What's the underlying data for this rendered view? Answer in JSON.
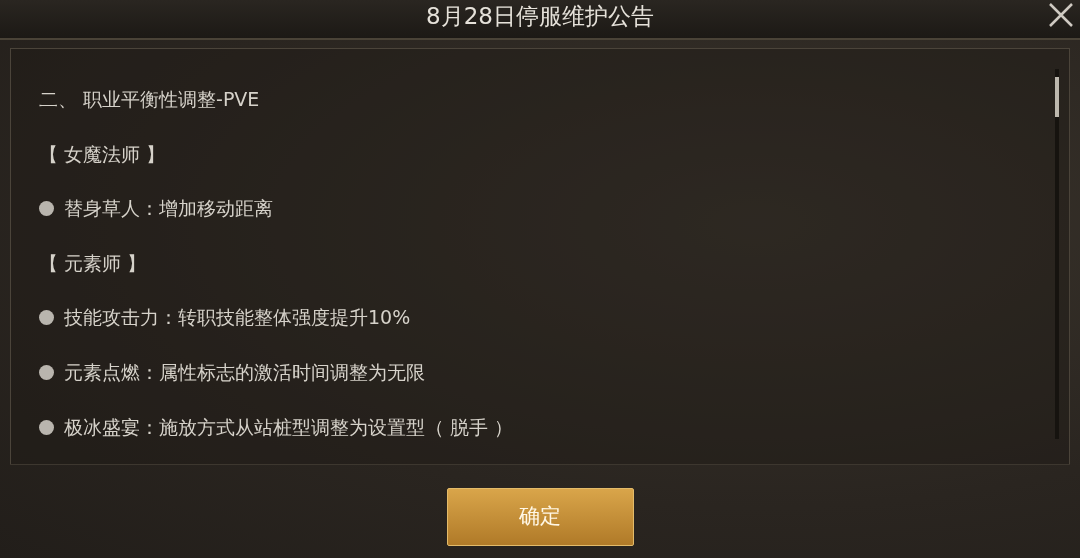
{
  "window": {
    "title": "8月28日停服维护公告"
  },
  "lines": [
    {
      "kind": "heading",
      "text": "二、 职业平衡性调整-PVE"
    },
    {
      "kind": "category",
      "text": "【 女魔法师 】"
    },
    {
      "kind": "bullet",
      "text": "替身草人：增加移动距离"
    },
    {
      "kind": "category",
      "text": "【 元素师 】"
    },
    {
      "kind": "bullet",
      "text": "技能攻击力：转职技能整体强度提升10%"
    },
    {
      "kind": "bullet",
      "text": "元素点燃：属性标志的激活时间调整为无限"
    },
    {
      "kind": "bullet",
      "text": "极冰盛宴：施放方式从站桩型调整为设置型（ 脱手 ）"
    }
  ],
  "confirm_button": {
    "label": "确定"
  }
}
